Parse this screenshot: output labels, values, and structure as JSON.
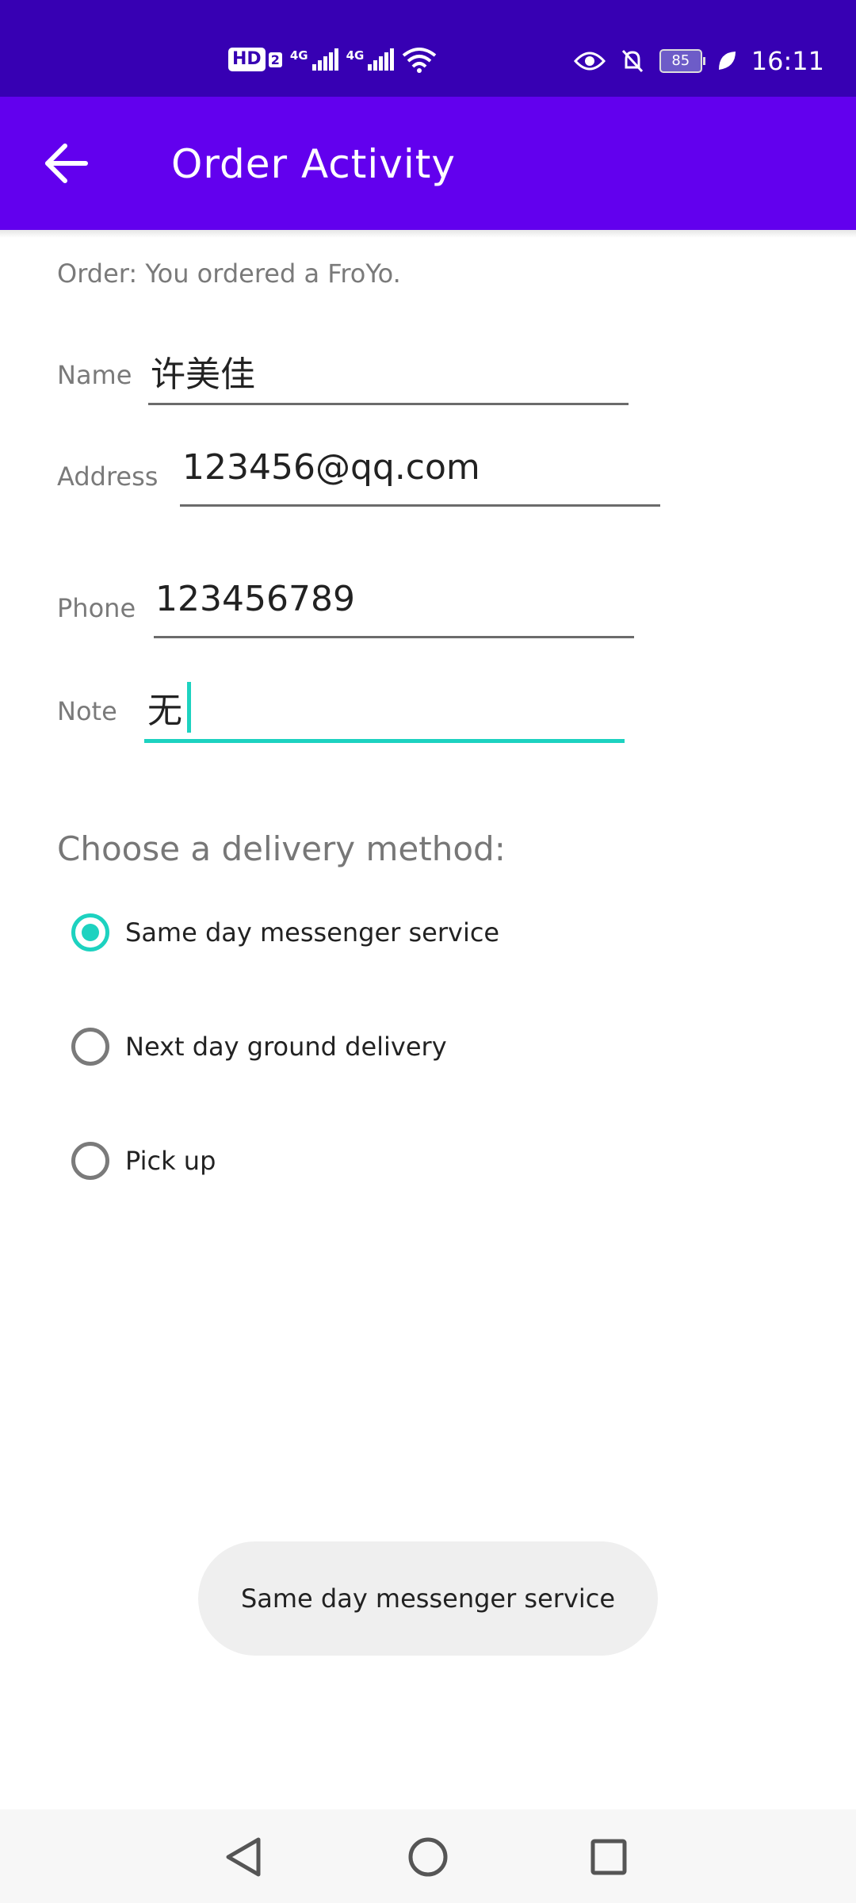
{
  "status_bar": {
    "hd_badge": "HD",
    "hd_sub": "2",
    "net1_label": "4G",
    "net2_label": "4G",
    "battery": "85",
    "time": "16:11",
    "icons": [
      "hd-icon",
      "signal-icon",
      "wifi-icon",
      "eye-icon",
      "bell-off-icon",
      "battery-icon",
      "leaf-icon"
    ]
  },
  "app_bar": {
    "title": "Order Activity",
    "back_icon": "arrow-left-icon"
  },
  "order_text": "Order: You ordered a FroYo.",
  "form": {
    "name": {
      "label": "Name",
      "value": "许美佳"
    },
    "address": {
      "label": "Address",
      "value": "123456@qq.com"
    },
    "phone": {
      "label": "Phone",
      "value": "123456789"
    },
    "note": {
      "label": "Note",
      "value": "无"
    }
  },
  "delivery": {
    "title": "Choose a delivery method:",
    "options": [
      {
        "label": "Same day messenger service",
        "checked": true
      },
      {
        "label": "Next day ground delivery",
        "checked": false
      },
      {
        "label": "Pick up",
        "checked": false
      }
    ]
  },
  "toast": "Same day messenger service",
  "colors": {
    "status_bar": "#3700b3",
    "app_bar": "#6200ee",
    "accent": "#1dd2c0"
  },
  "nav_bar": {
    "icons": [
      "back-triangle-icon",
      "home-circle-icon",
      "recents-square-icon"
    ]
  }
}
